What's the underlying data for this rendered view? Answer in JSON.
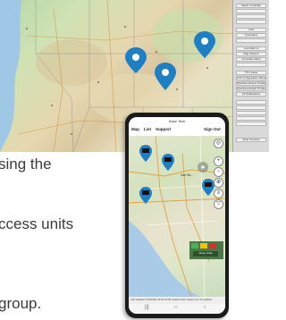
{
  "desktop": {
    "side_menu": [
      "Select Controller",
      "",
      "",
      "",
      "Units",
      "Controllers",
      "",
      "Controller UI",
      "Map Options",
      "Controller Alerts",
      "",
      "TTC Views",
      "Unit Configuration Manager",
      "Workflow Report Problems",
      "Operational Alert Problems",
      "All Notifications",
      "",
      "",
      "",
      "",
      "",
      "Solar Services"
    ]
  },
  "copy": {
    "line1": "sing the",
    "line2": "ccess units",
    "line3": "group."
  },
  "phone": {
    "app_title": "Solar Tech",
    "nav": {
      "map": "Map",
      "list": "List",
      "support": "Support",
      "sign_out": "Sign Out"
    },
    "city_label": "San Be...",
    "ctrl_plus": "+",
    "ctrl_minus": "−",
    "legend_button": "Close Units",
    "status_text": "Last Updated: 12/14/2021 11:54:13 AM   Location Note   markers are not updated",
    "navbar": {
      "left": "|||",
      "center": "○",
      "right": "‹"
    }
  },
  "colors": {
    "marker": "#1f7fc4",
    "marker_dark": "#165f96",
    "phone_dark": "#1b1b1b"
  }
}
